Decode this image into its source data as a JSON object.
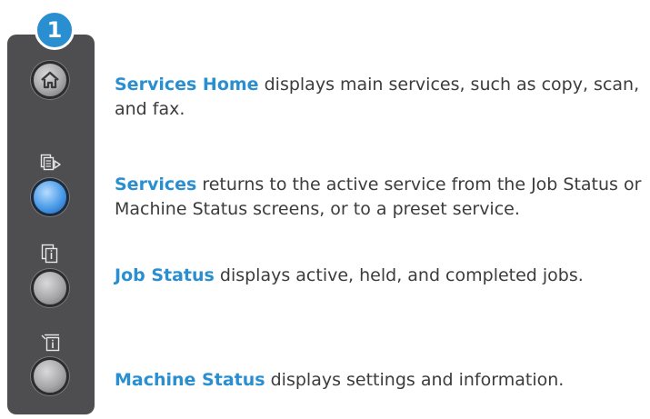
{
  "callout": {
    "number": "1"
  },
  "panel": {
    "buttons": [
      {
        "name": "Services Home",
        "icon": "home-icon",
        "color": "#a7a7aa"
      },
      {
        "name": "Services",
        "icon": "services-icon",
        "color": "#4a9be8"
      },
      {
        "name": "Job Status",
        "icon": "job-status-icon",
        "color": "#a7a7aa"
      },
      {
        "name": "Machine Status",
        "icon": "machine-status-icon",
        "color": "#a7a7aa"
      }
    ]
  },
  "descriptions": [
    {
      "term": "Services Home",
      "text": " displays main services, such as copy, scan, and fax."
    },
    {
      "term": "Services",
      "text": " returns to the active service from the Job Status or Machine Status screens, or to a preset service."
    },
    {
      "term": "Job Status",
      "text": " displays active, held, and completed jobs."
    },
    {
      "term": "Machine Status",
      "text": " displays settings and information."
    }
  ],
  "colors": {
    "accent": "#2a8fd1",
    "panel": "#4e4e50",
    "body_text": "#3c3c3c"
  }
}
